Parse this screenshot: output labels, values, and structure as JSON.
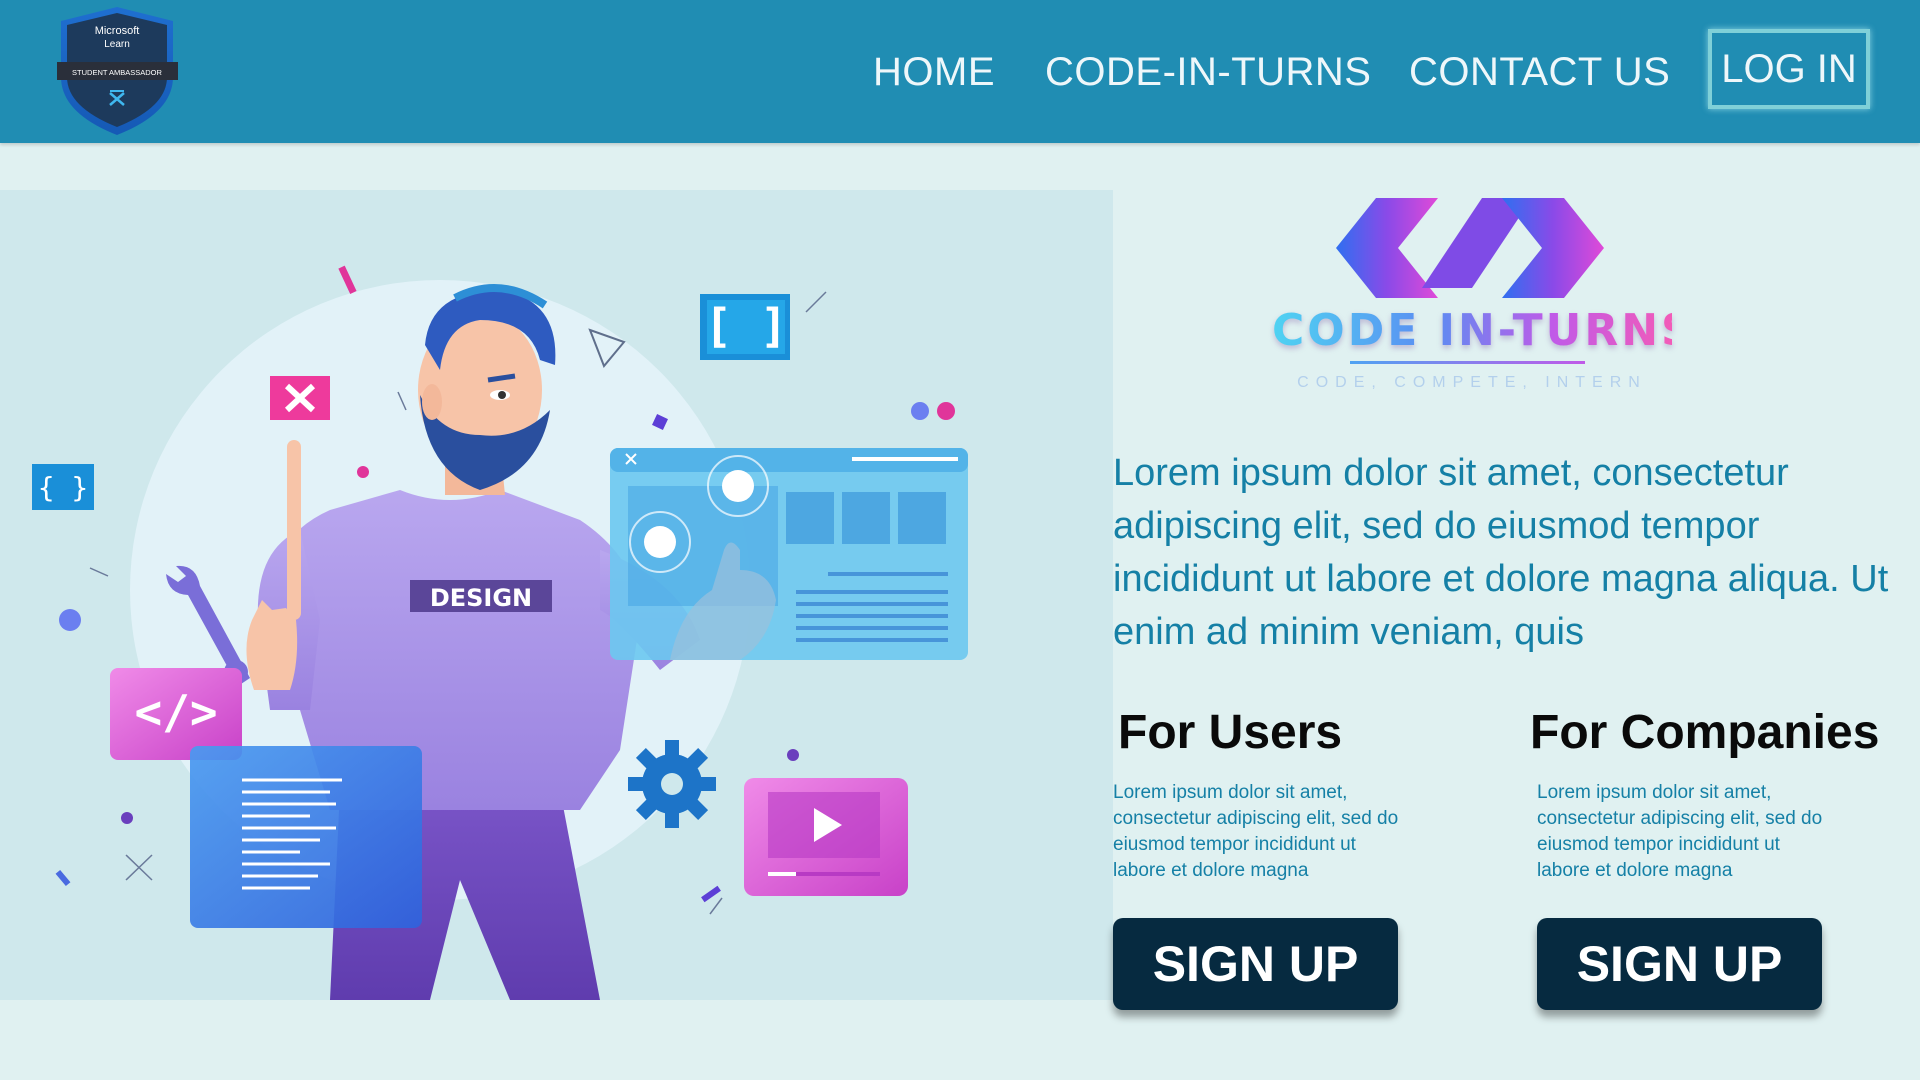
{
  "header": {
    "badge": {
      "line1": "Microsoft",
      "line2": "Learn",
      "ribbon": "STUDENT AMBASSADOR"
    },
    "nav": {
      "home": "HOME",
      "code_in_turns": "CODE-IN-TURNS",
      "contact": "CONTACT US",
      "login": "LOG IN"
    }
  },
  "hero": {
    "shirt_label": "DESIGN",
    "icons": [
      "close-icon",
      "brackets-icon",
      "wrench-icon",
      "code-icon",
      "gear-icon",
      "play-icon"
    ]
  },
  "brand": {
    "wordmark": "CODE IN-TURNS",
    "tagline": "CODE, COMPETE, INTERN"
  },
  "intro": "Lorem ipsum dolor sit amet, consectetur adipiscing elit, sed do eiusmod tempor incididunt ut labore et dolore magna aliqua. Ut enim ad minim veniam, quis",
  "users": {
    "title": "For Users",
    "text": "Lorem ipsum dolor sit amet, consectetur adipiscing elit, sed do eiusmod tempor incididunt ut labore et dolore magna",
    "button": "SIGN UP"
  },
  "companies": {
    "title": "For Companies",
    "text": "Lorem ipsum dolor sit amet, consectetur adipiscing elit, sed do eiusmod tempor incididunt ut labore et dolore magna",
    "button": "SIGN UP"
  },
  "colors": {
    "header": "#208db3",
    "page": "#e0f1f1",
    "button": "#062a40",
    "body_text": "#1580a6"
  }
}
